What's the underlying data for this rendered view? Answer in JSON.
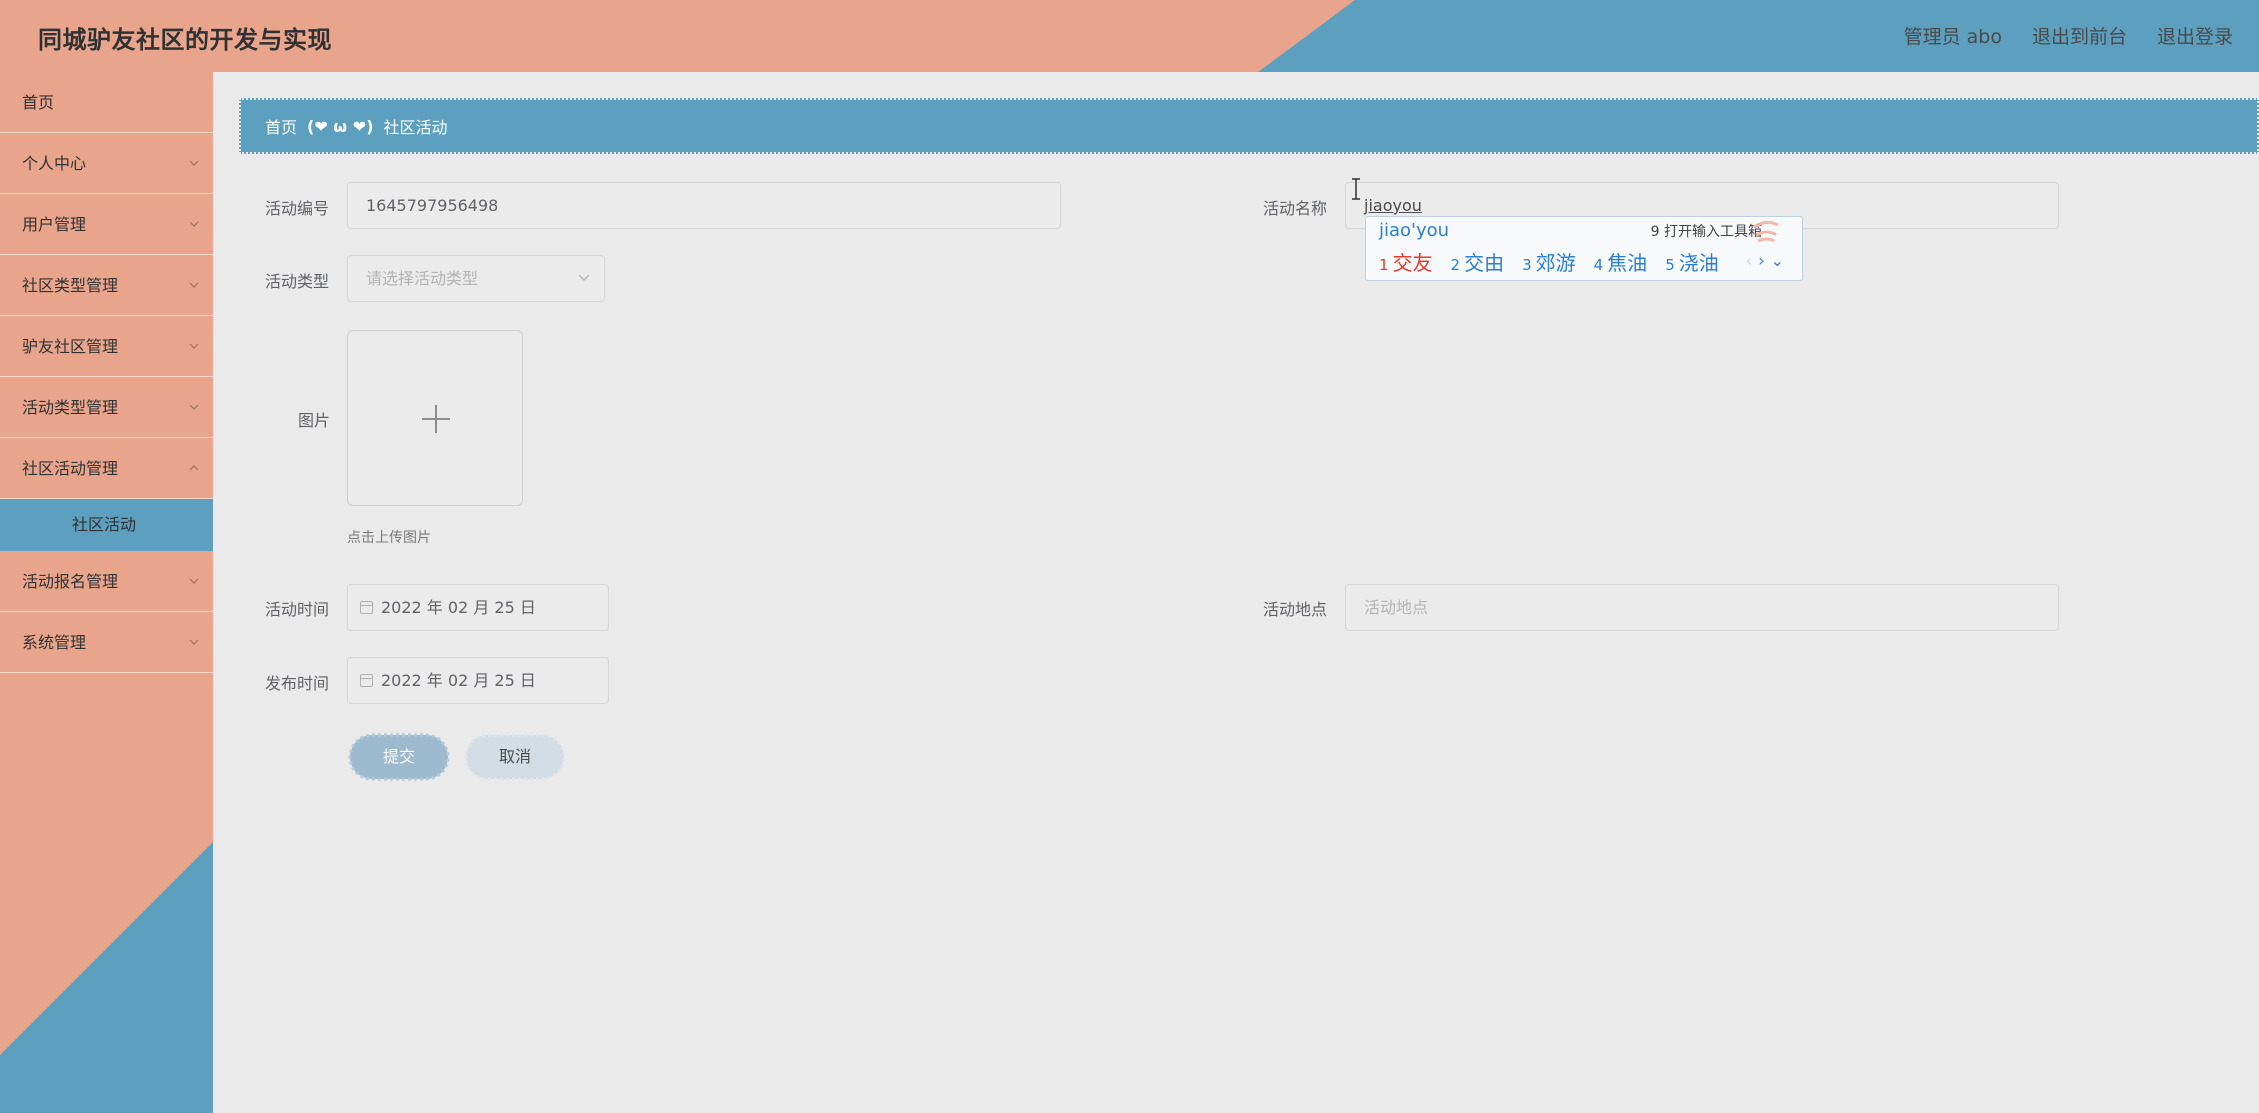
{
  "header": {
    "title": "同城驴友社区的开发与实现",
    "admin_label": "管理员 abo",
    "to_front": "退出到前台",
    "logout": "退出登录"
  },
  "colors": {
    "salmon": "#e8a58c",
    "blue": "#5d9fbf",
    "bg": "#eaeaea"
  },
  "sidebar": {
    "items": [
      {
        "label": "首页"
      },
      {
        "label": "个人中心"
      },
      {
        "label": "用户管理"
      },
      {
        "label": "社区类型管理"
      },
      {
        "label": "驴友社区管理"
      },
      {
        "label": "活动类型管理"
      },
      {
        "label": "社区活动管理"
      },
      {
        "label": "活动报名管理"
      },
      {
        "label": "系统管理"
      }
    ],
    "active_sub": "社区活动"
  },
  "breadcrumb": {
    "home": "首页",
    "separator": "(❤ ω ❤)",
    "current": "社区活动"
  },
  "form": {
    "activity_no_label": "活动编号",
    "activity_no_value": "1645797956498",
    "activity_name_label": "活动名称",
    "activity_name_value": "jiaoyou",
    "activity_type_label": "活动类型",
    "activity_type_placeholder": "请选择活动类型",
    "image_label": "图片",
    "upload_hint": "点击上传图片",
    "activity_time_label": "活动时间",
    "activity_time_value": "2022 年 02 月 25 日",
    "location_label": "活动地点",
    "location_placeholder": "活动地点",
    "publish_time_label": "发布时间",
    "publish_time_value": "2022 年 02 月 25 日",
    "submit_label": "提交",
    "cancel_label": "取消"
  },
  "ime": {
    "composition": "jiao'you",
    "toolbox": "9 打开输入工具箱",
    "candidates": [
      {
        "num": "1",
        "text": "交友"
      },
      {
        "num": "2",
        "text": "交由"
      },
      {
        "num": "3",
        "text": "郊游"
      },
      {
        "num": "4",
        "text": "焦油"
      },
      {
        "num": "5",
        "text": "浇油"
      }
    ]
  }
}
